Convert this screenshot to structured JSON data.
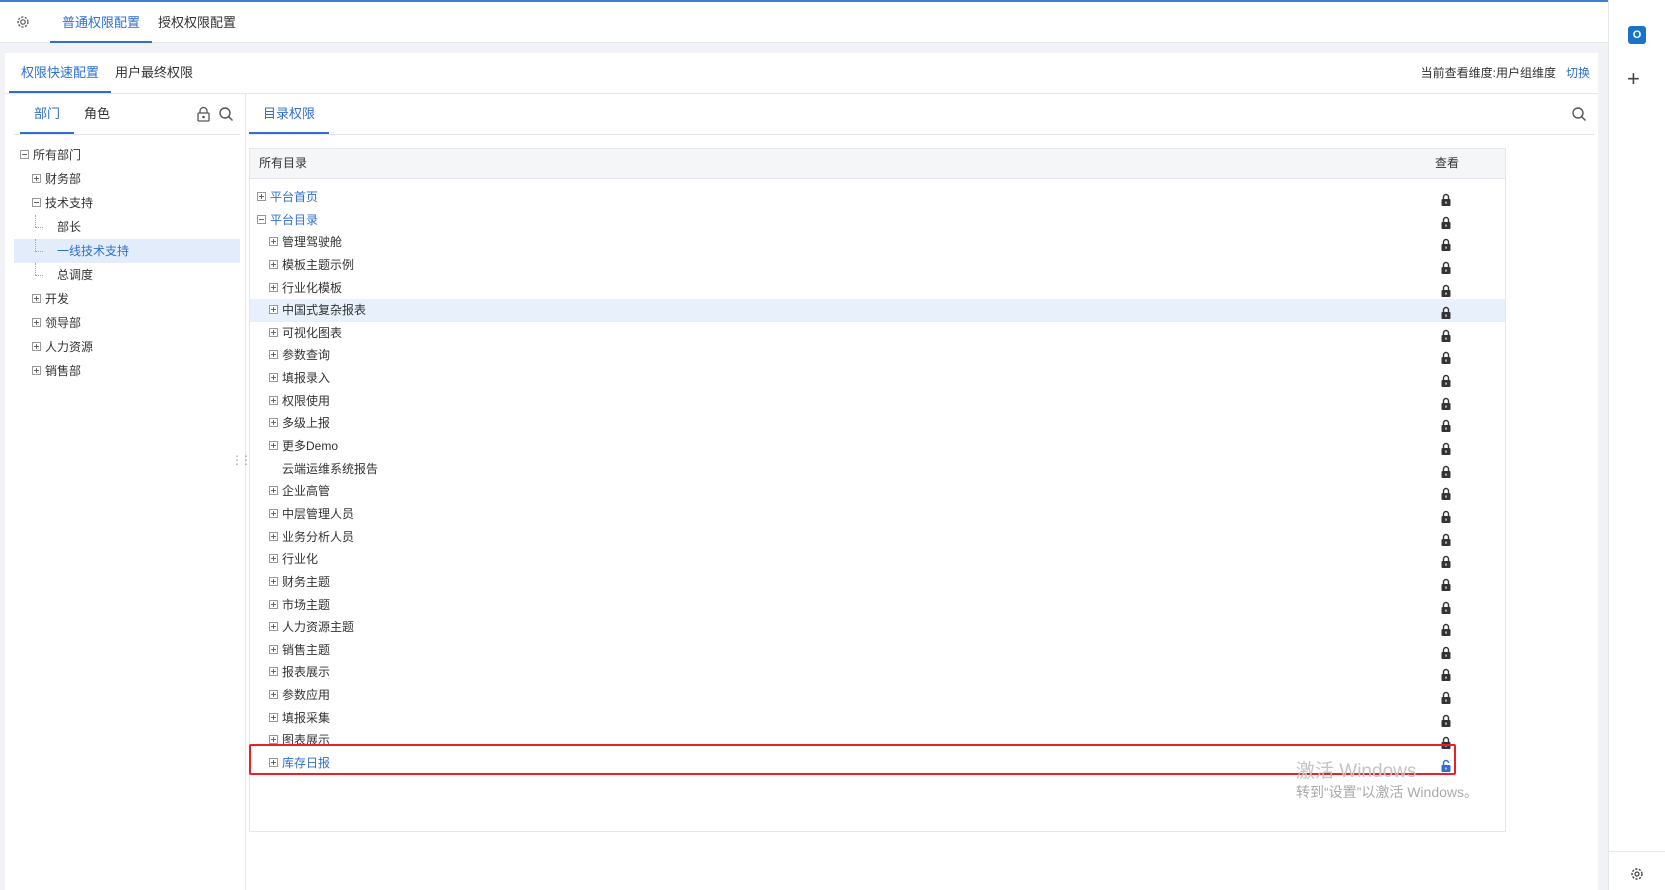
{
  "top_tabs": [
    "普通权限配置",
    "授权权限配置"
  ],
  "sub_tabs": [
    "权限快速配置",
    "用户最终权限"
  ],
  "dimension_label": "当前查看维度:用户组维度",
  "switch_label": "切换",
  "left_tabs": [
    "部门",
    "角色"
  ],
  "dept_tree": [
    {
      "label": "所有部门",
      "level": 0,
      "toggle": "minus"
    },
    {
      "label": "财务部",
      "level": 1,
      "toggle": "plus"
    },
    {
      "label": "技术支持",
      "level": 1,
      "toggle": "minus"
    },
    {
      "label": "部长",
      "level": 2,
      "toggle": "none"
    },
    {
      "label": "一线技术支持",
      "level": 2,
      "toggle": "none",
      "selected": true
    },
    {
      "label": "总调度",
      "level": 2,
      "toggle": "none"
    },
    {
      "label": "开发",
      "level": 1,
      "toggle": "plus"
    },
    {
      "label": "领导部",
      "level": 1,
      "toggle": "plus"
    },
    {
      "label": "人力资源",
      "level": 1,
      "toggle": "plus"
    },
    {
      "label": "销售部",
      "level": 1,
      "toggle": "plus"
    }
  ],
  "right_tab": "目录权限",
  "dir_header": {
    "name": "所有目录",
    "view": "查看"
  },
  "directory": [
    {
      "label": "平台首页",
      "level": 0,
      "toggle": "plus",
      "blue": true,
      "lock": "locked"
    },
    {
      "label": "平台目录",
      "level": 0,
      "toggle": "minus",
      "blue": true,
      "lock": "locked"
    },
    {
      "label": "管理驾驶舱",
      "level": 1,
      "toggle": "plus",
      "lock": "locked"
    },
    {
      "label": "模板主题示例",
      "level": 1,
      "toggle": "plus",
      "lock": "locked"
    },
    {
      "label": "行业化模板",
      "level": 1,
      "toggle": "plus",
      "lock": "locked"
    },
    {
      "label": "中国式复杂报表",
      "level": 1,
      "toggle": "plus",
      "lock": "locked",
      "highlight": true
    },
    {
      "label": "可视化图表",
      "level": 1,
      "toggle": "plus",
      "lock": "locked"
    },
    {
      "label": "参数查询",
      "level": 1,
      "toggle": "plus",
      "lock": "locked"
    },
    {
      "label": "填报录入",
      "level": 1,
      "toggle": "plus",
      "lock": "locked"
    },
    {
      "label": "权限使用",
      "level": 1,
      "toggle": "plus",
      "lock": "locked"
    },
    {
      "label": "多级上报",
      "level": 1,
      "toggle": "plus",
      "lock": "locked"
    },
    {
      "label": "更多Demo",
      "level": 1,
      "toggle": "plus",
      "lock": "locked"
    },
    {
      "label": "云端运维系统报告",
      "level": 1,
      "toggle": "none",
      "lock": "locked"
    },
    {
      "label": "企业高管",
      "level": 1,
      "toggle": "plus",
      "lock": "locked"
    },
    {
      "label": "中层管理人员",
      "level": 1,
      "toggle": "plus",
      "lock": "locked"
    },
    {
      "label": "业务分析人员",
      "level": 1,
      "toggle": "plus",
      "lock": "locked"
    },
    {
      "label": "行业化",
      "level": 1,
      "toggle": "plus",
      "lock": "locked"
    },
    {
      "label": "财务主题",
      "level": 1,
      "toggle": "plus",
      "lock": "locked"
    },
    {
      "label": "市场主题",
      "level": 1,
      "toggle": "plus",
      "lock": "locked"
    },
    {
      "label": "人力资源主题",
      "level": 1,
      "toggle": "plus",
      "lock": "locked"
    },
    {
      "label": "销售主题",
      "level": 1,
      "toggle": "plus",
      "lock": "locked"
    },
    {
      "label": "报表展示",
      "level": 1,
      "toggle": "plus",
      "lock": "locked"
    },
    {
      "label": "参数应用",
      "level": 1,
      "toggle": "plus",
      "lock": "locked"
    },
    {
      "label": "填报采集",
      "level": 1,
      "toggle": "plus",
      "lock": "locked"
    },
    {
      "label": "图表展示",
      "level": 1,
      "toggle": "plus",
      "lock": "locked"
    },
    {
      "label": "库存日报",
      "level": 1,
      "toggle": "plus",
      "blue": true,
      "lock": "unlocked"
    }
  ],
  "watermark": {
    "line1": "激活 Windows",
    "line2": "转到“设置”以激活 Windows。"
  },
  "colors": {
    "accent": "#2f6fd1",
    "highlight_border": "#e8202a",
    "selected_bg": "#e3ecfa",
    "lock": "#333333"
  }
}
